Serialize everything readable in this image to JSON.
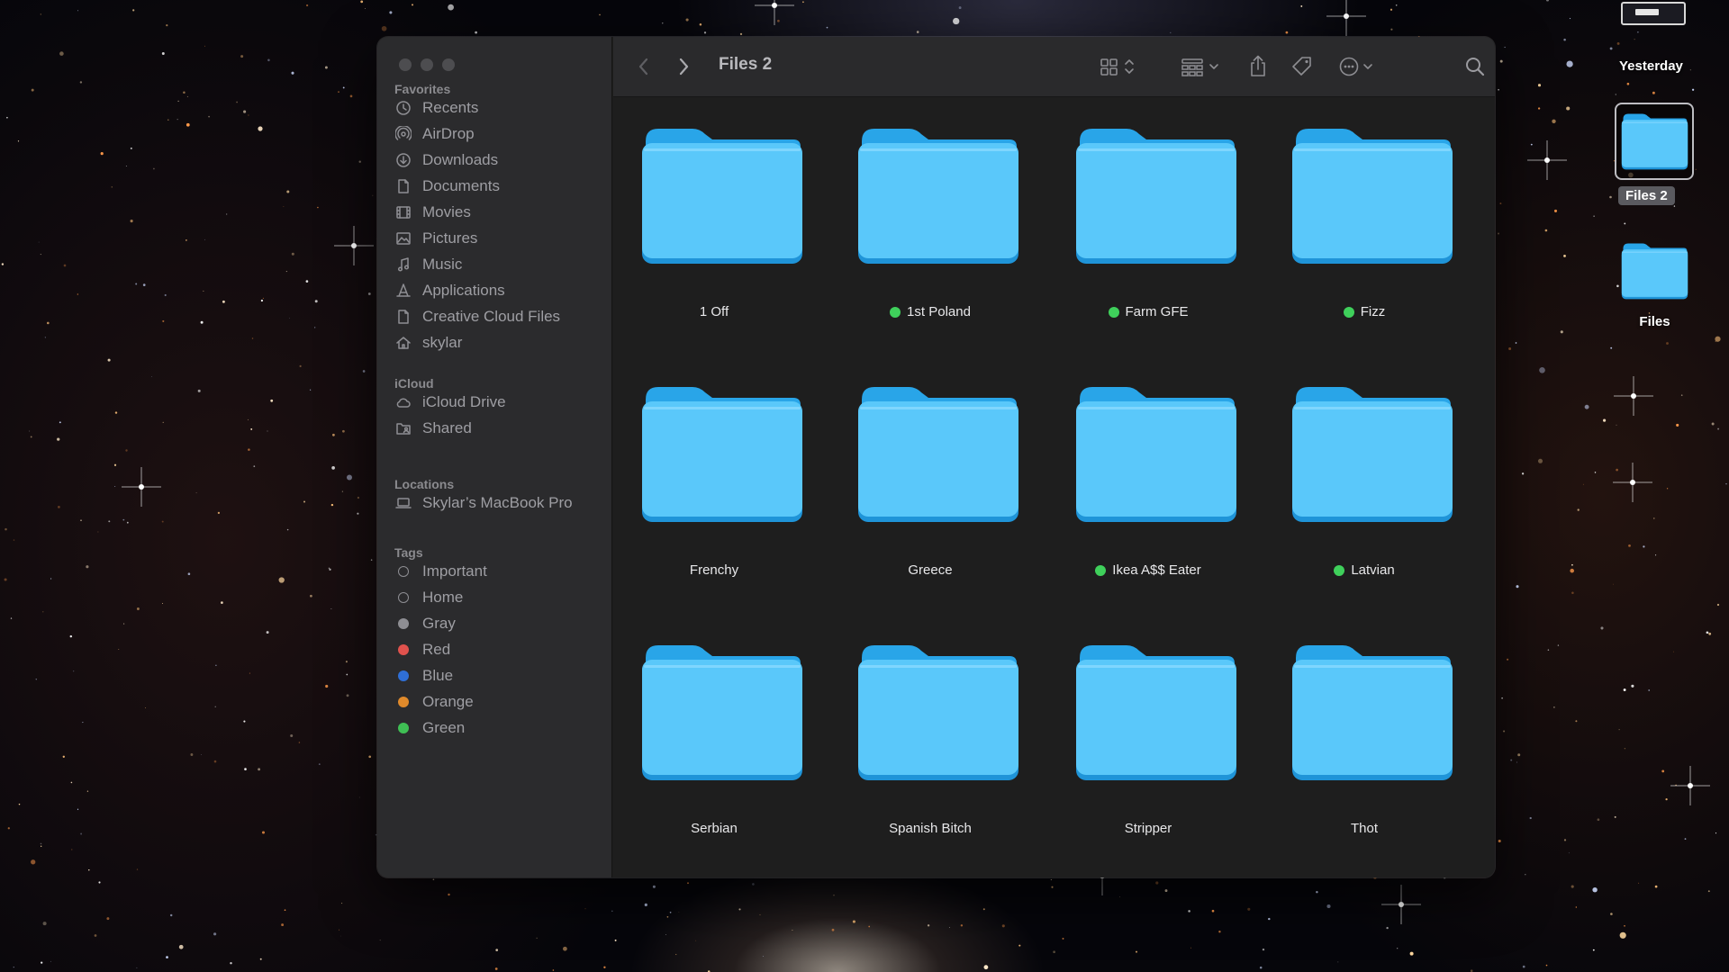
{
  "window": {
    "title": "Files 2"
  },
  "sidebar": {
    "sections": [
      {
        "title": "Favorites",
        "items": [
          {
            "label": "Recents",
            "icon": "clock-icon"
          },
          {
            "label": "AirDrop",
            "icon": "airdrop-icon"
          },
          {
            "label": "Downloads",
            "icon": "download-icon"
          },
          {
            "label": "Documents",
            "icon": "document-icon"
          },
          {
            "label": "Movies",
            "icon": "film-icon"
          },
          {
            "label": "Pictures",
            "icon": "photo-icon"
          },
          {
            "label": "Music",
            "icon": "music-note-icon"
          },
          {
            "label": "Applications",
            "icon": "applications-icon"
          },
          {
            "label": "Creative Cloud Files",
            "icon": "document-icon"
          },
          {
            "label": "skylar",
            "icon": "home-icon"
          }
        ]
      },
      {
        "title": "iCloud",
        "items": [
          {
            "label": "iCloud Drive",
            "icon": "cloud-icon"
          },
          {
            "label": "Shared",
            "icon": "shared-folder-icon"
          }
        ]
      },
      {
        "title": "Locations",
        "items": [
          {
            "label": "Skylar’s MacBook Pro",
            "icon": "laptop-icon"
          }
        ]
      },
      {
        "title": "Tags",
        "items": [
          {
            "label": "Important",
            "color": ""
          },
          {
            "label": "Home",
            "color": ""
          },
          {
            "label": "Gray",
            "color": "#8e8e93"
          },
          {
            "label": "Red",
            "color": "#e0524d"
          },
          {
            "label": "Blue",
            "color": "#2f6fd6"
          },
          {
            "label": "Orange",
            "color": "#e08a2b"
          },
          {
            "label": "Green",
            "color": "#3fbf54"
          }
        ]
      }
    ]
  },
  "toolbar": {
    "back_icon": "chevron-left-icon",
    "forward_icon": "chevron-right-icon",
    "view_icon": "icon-grid-icon",
    "group_icon": "group-grid-icon",
    "share_icon": "share-icon",
    "tag_icon": "tag-icon",
    "more_icon": "ellipsis-circle-icon",
    "search_icon": "search-icon"
  },
  "folders": [
    {
      "name": "1 Off",
      "tagged": false
    },
    {
      "name": "1st Poland",
      "tagged": true
    },
    {
      "name": "Farm GFE",
      "tagged": true
    },
    {
      "name": "Fizz",
      "tagged": true
    },
    {
      "name": "Frenchy",
      "tagged": false
    },
    {
      "name": "Greece",
      "tagged": false
    },
    {
      "name": "Ikea A$$ Eater",
      "tagged": true
    },
    {
      "name": "Latvian",
      "tagged": true
    },
    {
      "name": "Serbian",
      "tagged": false
    },
    {
      "name": "Spanish Bitch",
      "tagged": false
    },
    {
      "name": "Stripper",
      "tagged": false
    },
    {
      "name": "Thot",
      "tagged": false
    }
  ],
  "tag_color": "#3fd05b",
  "folder_color": "#5ac8fa",
  "desktop": {
    "stack_label": "Yesterday",
    "items": [
      {
        "label": "Files 2",
        "selected": true
      },
      {
        "label": "Files",
        "selected": false
      }
    ]
  }
}
